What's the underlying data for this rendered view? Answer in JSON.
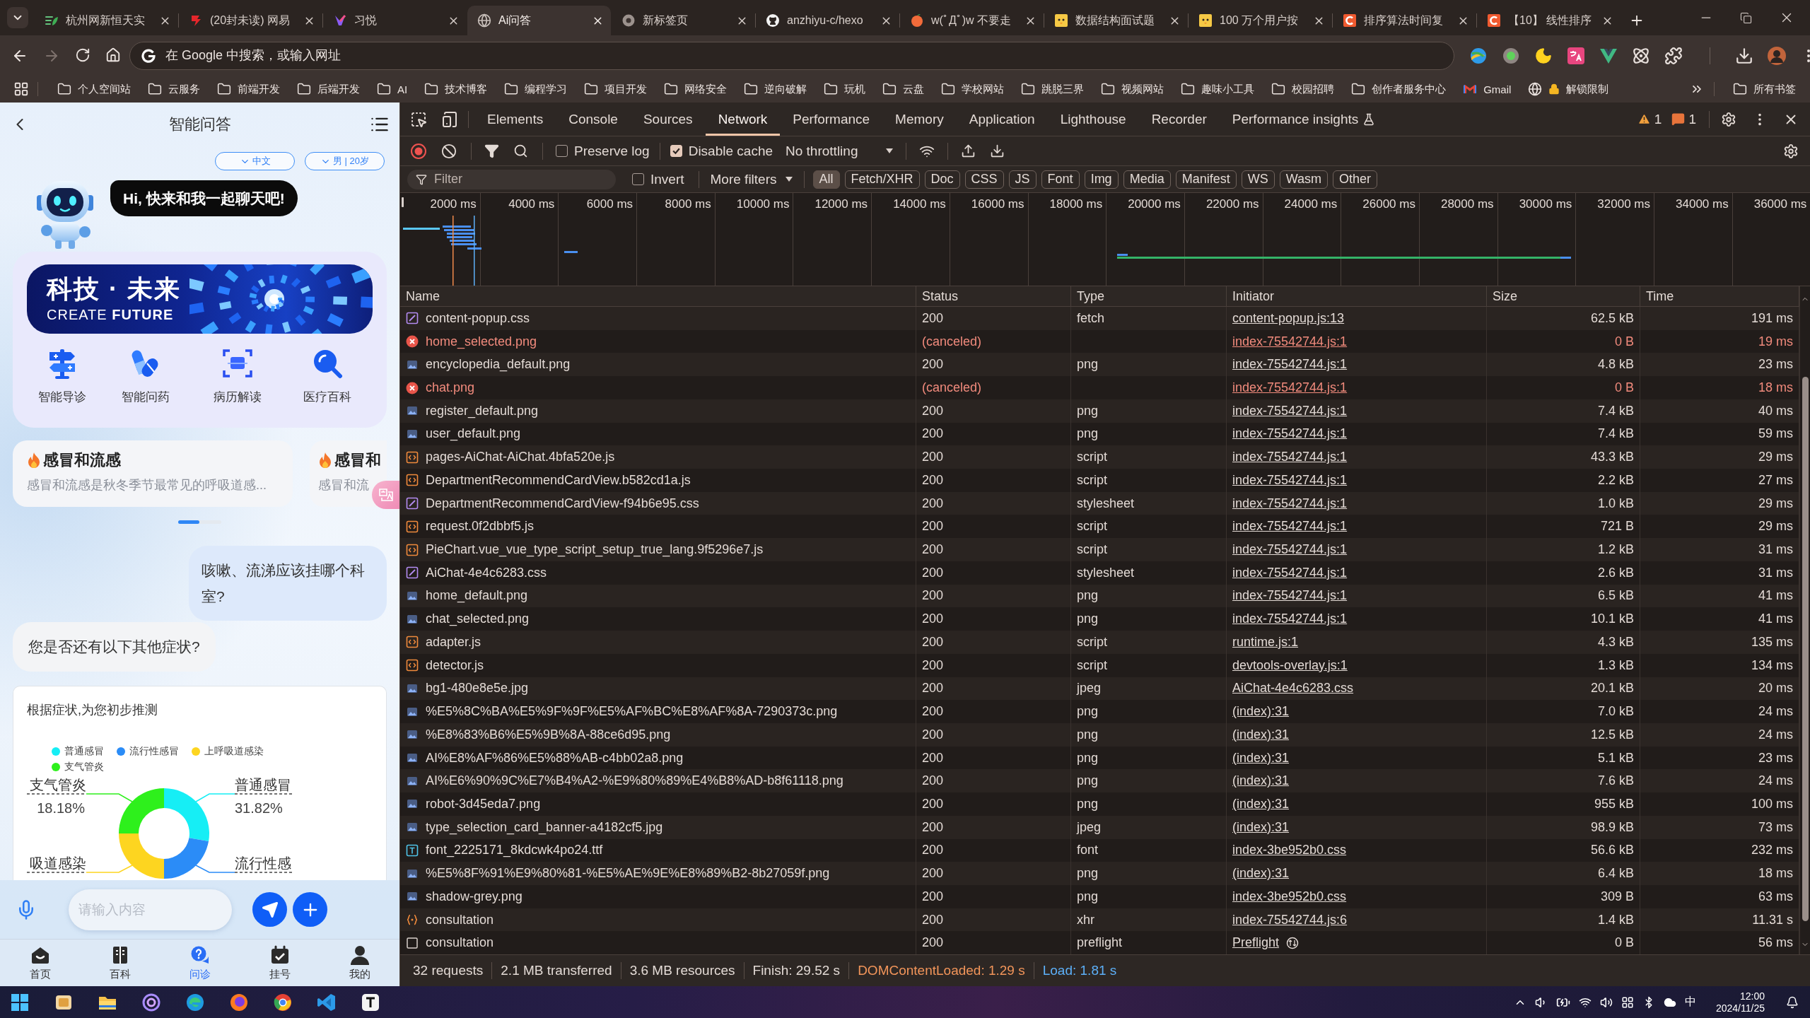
{
  "browser": {
    "tabs": [
      {
        "title": "杭州网新恒天实",
        "selected": false
      },
      {
        "title": "(20封未读) 网易",
        "selected": false
      },
      {
        "title": "习悦",
        "selected": false
      },
      {
        "title": "Ai问答",
        "selected": true
      },
      {
        "title": "新标签页",
        "selected": false
      },
      {
        "title": "anzhiyu-c/hexo",
        "selected": false
      },
      {
        "title": "w(ﾟДﾟ)w 不要走",
        "selected": false
      },
      {
        "title": "数据结构面试题",
        "selected": false
      },
      {
        "title": "100 万个用户按",
        "selected": false
      },
      {
        "title": "排序算法时间复",
        "selected": false
      },
      {
        "title": "【10】 线性排序",
        "selected": false
      }
    ],
    "forward": {
      "disabled": true
    },
    "address_bar": {
      "placeholder": "在 Google 中搜索，或输入网址"
    },
    "bookmarks": [
      {
        "label": "个人空间站",
        "kind": "folder"
      },
      {
        "label": "云服务",
        "kind": "folder"
      },
      {
        "label": "前端开发",
        "kind": "folder"
      },
      {
        "label": "后端开发",
        "kind": "folder"
      },
      {
        "label": "AI",
        "kind": "folder"
      },
      {
        "label": "技术博客",
        "kind": "folder"
      },
      {
        "label": "编程学习",
        "kind": "folder"
      },
      {
        "label": "项目开发",
        "kind": "folder"
      },
      {
        "label": "网络安全",
        "kind": "folder"
      },
      {
        "label": "逆向破解",
        "kind": "folder"
      },
      {
        "label": "玩机",
        "kind": "folder"
      },
      {
        "label": "云盘",
        "kind": "folder"
      },
      {
        "label": "学校网站",
        "kind": "folder"
      },
      {
        "label": "跳脱三界",
        "kind": "folder"
      },
      {
        "label": "视频网站",
        "kind": "folder"
      },
      {
        "label": "趣味小工具",
        "kind": "folder"
      },
      {
        "label": "校园招聘",
        "kind": "folder"
      },
      {
        "label": "创作者服务中心",
        "kind": "folder"
      },
      {
        "label": "Gmail",
        "kind": "mail"
      },
      {
        "label": "解锁限制",
        "kind": "locked"
      }
    ],
    "all_bookmarks": {
      "label": "所有书签"
    }
  },
  "app": {
    "title": "智能问答",
    "selectors": [
      {
        "label": "中文"
      },
      {
        "label": "男 | 20岁"
      }
    ],
    "greeting": "Hi, 快来和我一起聊天吧!",
    "banner": {
      "title": "科技 · 未来",
      "subtitle": "CREATE **FUTURE**"
    },
    "features": [
      {
        "label": "智能导诊"
      },
      {
        "label": "智能问药"
      },
      {
        "label": "病历解读"
      },
      {
        "label": "医疗百科"
      }
    ],
    "topics": [
      {
        "title": "感冒和流感",
        "summary": "感冒和流感是秋冬季节最常见的呼吸道感..."
      },
      {
        "title": "感冒和",
        "summary": "感冒和流"
      }
    ],
    "messages": [
      {
        "kind": "user",
        "text": "咳嗽、流涕应该挂哪个科室?"
      },
      {
        "kind": "bot",
        "text": "您是否还有以下其他症状?"
      }
    ],
    "prediction": {
      "title": "根据症状,为您初步推测",
      "legend": [
        {
          "label": "普通感冒",
          "color": "#16eef5"
        },
        {
          "label": "流行性感冒",
          "color": "#2b8cf7"
        },
        {
          "label": "上呼吸道感染",
          "color": "#fdd520"
        },
        {
          "label": "支气管炎",
          "color": "#2ef01c"
        }
      ],
      "callouts": [
        {
          "label": "支气管炎",
          "share": "18.18%",
          "color": "#2ef01c"
        },
        {
          "label": "普通感冒",
          "share": "31.82%",
          "color": "#16eef5"
        },
        {
          "label": "吸道感染",
          "color": "#fdd520"
        },
        {
          "label": "流行性感",
          "color": "#2b8cf7"
        }
      ]
    },
    "input": {
      "placeholder": "请输入内容"
    },
    "nav": [
      {
        "label": "首页",
        "selected": false
      },
      {
        "label": "百科",
        "selected": false
      },
      {
        "label": "问诊",
        "selected": true
      },
      {
        "label": "挂号",
        "selected": false
      },
      {
        "label": "我的",
        "selected": false
      }
    ]
  },
  "devtools": {
    "panels": [
      {
        "label": "Elements",
        "selected": false,
        "experimental": false
      },
      {
        "label": "Console",
        "selected": false,
        "experimental": false
      },
      {
        "label": "Sources",
        "selected": false,
        "experimental": false
      },
      {
        "label": "Network",
        "selected": true,
        "experimental": false
      },
      {
        "label": "Performance",
        "selected": false,
        "experimental": false
      },
      {
        "label": "Memory",
        "selected": false,
        "experimental": false
      },
      {
        "label": "Application",
        "selected": false,
        "experimental": false
      },
      {
        "label": "Lighthouse",
        "selected": false,
        "experimental": false
      },
      {
        "label": "Recorder",
        "selected": false,
        "experimental": false
      },
      {
        "label": "Performance insights",
        "selected": false,
        "experimental": true
      }
    ],
    "counters": [
      {
        "kind": "warning",
        "count": "1"
      },
      {
        "kind": "issue",
        "count": "1"
      }
    ],
    "recording": true,
    "preserve_log": {
      "label": "Preserve log",
      "checked": false
    },
    "disable_cache": {
      "label": "Disable cache",
      "checked": true
    },
    "throttling": {
      "value": "No throttling"
    },
    "filter": {
      "placeholder": "Filter"
    },
    "invert": {
      "label": "Invert",
      "checked": false
    },
    "more_filters": {
      "label": "More filters"
    },
    "types": [
      {
        "label": "All",
        "selected": true
      },
      {
        "label": "Fetch/XHR",
        "selected": false
      },
      {
        "label": "Doc",
        "selected": false
      },
      {
        "label": "CSS",
        "selected": false
      },
      {
        "label": "JS",
        "selected": false
      },
      {
        "label": "Font",
        "selected": false
      },
      {
        "label": "Img",
        "selected": false
      },
      {
        "label": "Media",
        "selected": false
      },
      {
        "label": "Manifest",
        "selected": false
      },
      {
        "label": "WS",
        "selected": false
      },
      {
        "label": "Wasm",
        "selected": false
      },
      {
        "label": "Other",
        "selected": false
      }
    ],
    "timeline": {
      "ticks": [
        "2000 ms",
        "4000 ms",
        "6000 ms",
        "8000 ms",
        "10000 ms",
        "12000 ms",
        "14000 ms",
        "16000 ms",
        "18000 ms",
        "20000 ms",
        "22000 ms",
        "24000 ms",
        "26000 ms",
        "28000 ms",
        "30000 ms",
        "32000 ms",
        "34000 ms",
        "36000 ms"
      ]
    },
    "table": {
      "columns": [
        "Name",
        "Status",
        "Type",
        "Initiator",
        "Size",
        "Time"
      ],
      "rows": [
        {
          "name": "content-popup.css",
          "status": "200",
          "type": "fetch",
          "initiator": "content-popup.js:13",
          "size": "62.5 kB",
          "time": "191 ms",
          "kind": "stylesheet",
          "failed": false
        },
        {
          "name": "home_selected.png",
          "status": "(canceled)",
          "initiator": "index-75542744.js:1",
          "size": "0 B",
          "time": "19 ms",
          "kind": "image",
          "failed": true
        },
        {
          "name": "encyclopedia_default.png",
          "status": "200",
          "type": "png",
          "initiator": "index-75542744.js:1",
          "size": "4.8 kB",
          "time": "23 ms",
          "kind": "image",
          "failed": false
        },
        {
          "name": "chat.png",
          "status": "(canceled)",
          "initiator": "index-75542744.js:1",
          "size": "0 B",
          "time": "18 ms",
          "kind": "image",
          "failed": true
        },
        {
          "name": "register_default.png",
          "status": "200",
          "type": "png",
          "initiator": "index-75542744.js:1",
          "size": "7.4 kB",
          "time": "40 ms",
          "kind": "image",
          "failed": false
        },
        {
          "name": "user_default.png",
          "status": "200",
          "type": "png",
          "initiator": "index-75542744.js:1",
          "size": "7.4 kB",
          "time": "59 ms",
          "kind": "image",
          "failed": false
        },
        {
          "name": "pages-AiChat-AiChat.4bfa520e.js",
          "status": "200",
          "type": "script",
          "initiator": "index-75542744.js:1",
          "size": "43.3 kB",
          "time": "29 ms",
          "kind": "script",
          "failed": false
        },
        {
          "name": "DepartmentRecommendCardView.b582cd1a.js",
          "status": "200",
          "type": "script",
          "initiator": "index-75542744.js:1",
          "size": "2.2 kB",
          "time": "27 ms",
          "kind": "script",
          "failed": false
        },
        {
          "name": "DepartmentRecommendCardView-f94b6e95.css",
          "status": "200",
          "type": "stylesheet",
          "initiator": "index-75542744.js:1",
          "size": "1.0 kB",
          "time": "29 ms",
          "kind": "stylesheet",
          "failed": false
        },
        {
          "name": "request.0f2dbbf5.js",
          "status": "200",
          "type": "script",
          "initiator": "index-75542744.js:1",
          "size": "721 B",
          "time": "29 ms",
          "kind": "script",
          "failed": false
        },
        {
          "name": "PieChart.vue_vue_type_script_setup_true_lang.9f5296e7.js",
          "status": "200",
          "type": "script",
          "initiator": "index-75542744.js:1",
          "size": "1.2 kB",
          "time": "31 ms",
          "kind": "script",
          "failed": false
        },
        {
          "name": "AiChat-4e4c6283.css",
          "status": "200",
          "type": "stylesheet",
          "initiator": "index-75542744.js:1",
          "size": "2.6 kB",
          "time": "31 ms",
          "kind": "stylesheet",
          "failed": false
        },
        {
          "name": "home_default.png",
          "status": "200",
          "type": "png",
          "initiator": "index-75542744.js:1",
          "size": "6.5 kB",
          "time": "41 ms",
          "kind": "image",
          "failed": false
        },
        {
          "name": "chat_selected.png",
          "status": "200",
          "type": "png",
          "initiator": "index-75542744.js:1",
          "size": "10.1 kB",
          "time": "41 ms",
          "kind": "image",
          "failed": false
        },
        {
          "name": "adapter.js",
          "status": "200",
          "type": "script",
          "initiator": "runtime.js:1",
          "size": "4.3 kB",
          "time": "135 ms",
          "kind": "script",
          "failed": false
        },
        {
          "name": "detector.js",
          "status": "200",
          "type": "script",
          "initiator": "devtools-overlay.js:1",
          "size": "1.3 kB",
          "time": "134 ms",
          "kind": "script",
          "failed": false
        },
        {
          "name": "bg1-480e8e5e.jpg",
          "status": "200",
          "type": "jpeg",
          "initiator": "AiChat-4e4c6283.css",
          "size": "20.1 kB",
          "time": "20 ms",
          "kind": "image",
          "failed": false
        },
        {
          "name": "%E5%8C%BA%E5%9F%9F%E5%AF%BC%E8%AF%8A-7290373c.png",
          "status": "200",
          "type": "png",
          "initiator": "(index):31",
          "size": "7.0 kB",
          "time": "24 ms",
          "kind": "image",
          "failed": false
        },
        {
          "name": "%E8%83%B6%E5%9B%8A-88ce6d95.png",
          "status": "200",
          "type": "png",
          "initiator": "(index):31",
          "size": "12.5 kB",
          "time": "24 ms",
          "kind": "image",
          "failed": false
        },
        {
          "name": "AI%E8%AF%86%E5%88%AB-c4bb02a8.png",
          "status": "200",
          "type": "png",
          "initiator": "(index):31",
          "size": "5.1 kB",
          "time": "23 ms",
          "kind": "image",
          "failed": false
        },
        {
          "name": "AI%E6%90%9C%E7%B4%A2-%E9%80%89%E4%B8%AD-b8f61118.png",
          "status": "200",
          "type": "png",
          "initiator": "(index):31",
          "size": "7.6 kB",
          "time": "24 ms",
          "kind": "image",
          "failed": false
        },
        {
          "name": "robot-3d45eda7.png",
          "status": "200",
          "type": "png",
          "initiator": "(index):31",
          "size": "955 kB",
          "time": "100 ms",
          "kind": "image",
          "failed": false
        },
        {
          "name": "type_selection_card_banner-a4182cf5.jpg",
          "status": "200",
          "type": "jpeg",
          "initiator": "(index):31",
          "size": "98.9 kB",
          "time": "73 ms",
          "kind": "image",
          "failed": false
        },
        {
          "name": "font_2225171_8kdcwk4po24.ttf",
          "status": "200",
          "type": "font",
          "initiator": "index-3be952b0.css",
          "size": "56.6 kB",
          "time": "232 ms",
          "kind": "font",
          "failed": false
        },
        {
          "name": "%E5%8F%91%E9%80%81-%E5%AE%9E%E8%89%B2-8b27059f.png",
          "status": "200",
          "type": "png",
          "initiator": "(index):31",
          "size": "6.4 kB",
          "time": "18 ms",
          "kind": "image",
          "failed": false
        },
        {
          "name": "shadow-grey.png",
          "status": "200",
          "type": "png",
          "initiator": "index-3be952b0.css",
          "size": "309 B",
          "time": "63 ms",
          "kind": "image",
          "failed": false
        },
        {
          "name": "consultation",
          "status": "200",
          "type": "xhr",
          "initiator": "index-75542744.js:6",
          "size": "1.4 kB",
          "time": "11.31 s",
          "kind": "xhr",
          "failed": false
        },
        {
          "name": "consultation",
          "status": "200",
          "type": "preflight",
          "initiator": "Preflight",
          "size": "0 B",
          "time": "56 ms",
          "kind": "preflight",
          "failed": false
        }
      ]
    },
    "summary": [
      {
        "text": "32 requests",
        "kind": "plain"
      },
      {
        "text": "2.1 MB transferred",
        "kind": "plain"
      },
      {
        "text": "3.6 MB resources",
        "kind": "plain"
      },
      {
        "text": "Finish: 29.52 s",
        "kind": "plain"
      },
      {
        "text": "DOMContentLoaded: 1.29 s",
        "kind": "dom"
      },
      {
        "text": "Load: 1.81 s",
        "kind": "load"
      }
    ]
  },
  "taskbar": {
    "ime": "中",
    "time": "12:00",
    "date": "2024/11/25"
  }
}
